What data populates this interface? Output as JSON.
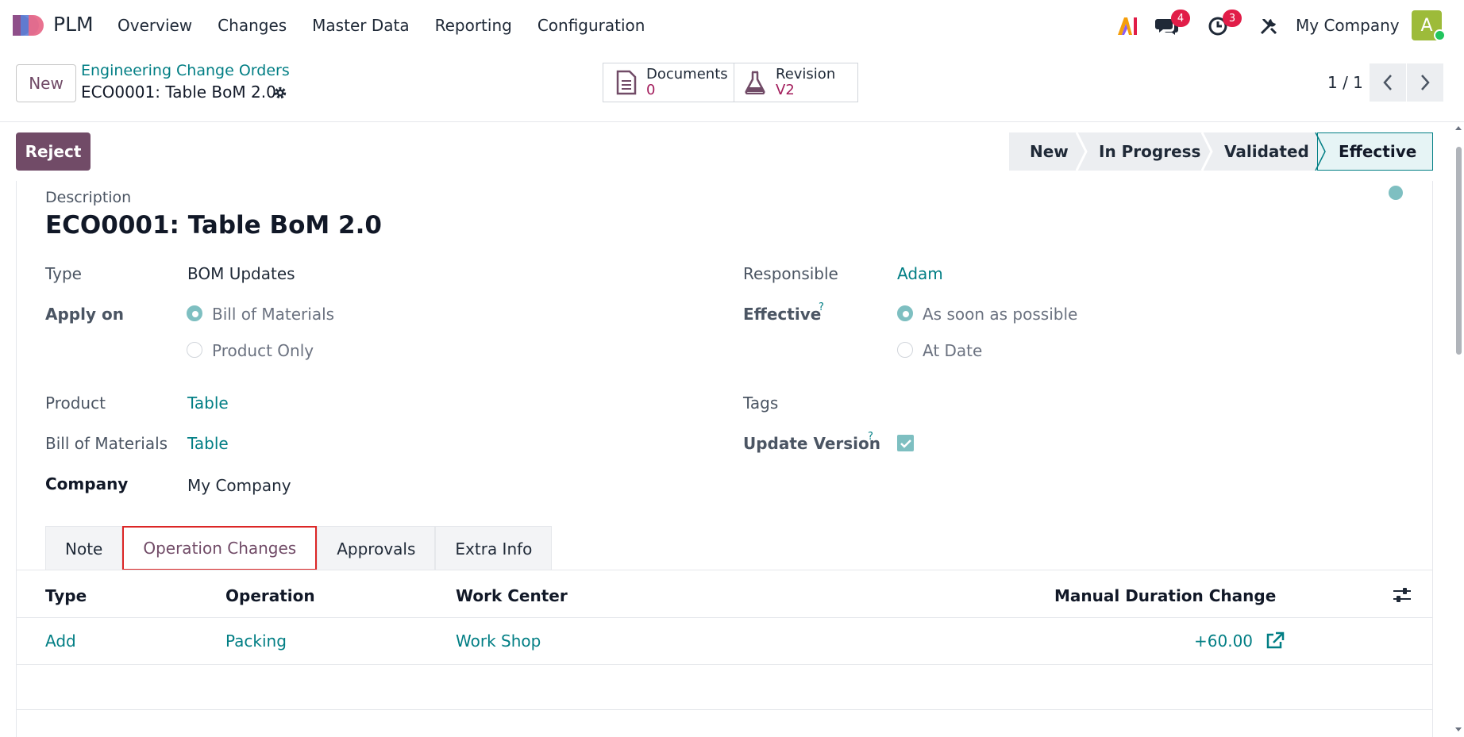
{
  "navbar": {
    "app_name": "PLM",
    "menu": [
      "Overview",
      "Changes",
      "Master Data",
      "Reporting",
      "Configuration"
    ],
    "messages_count": "4",
    "activities_count": "3",
    "company": "My Company",
    "avatar_letter": "A"
  },
  "control": {
    "new_label": "New",
    "breadcrumb_parent": "Engineering Change Orders",
    "breadcrumb_current": "ECO0001: Table BoM 2.0",
    "documents_label": "Documents",
    "documents_value": "0",
    "revision_label": "Revision",
    "revision_value": "V2",
    "pager": "1 / 1"
  },
  "statusbar": {
    "reject_label": "Reject",
    "stages": [
      "New",
      "In Progress",
      "Validated",
      "Effective"
    ],
    "active_stage": "Effective"
  },
  "form": {
    "description_label": "Description",
    "title": "ECO0001: Table BoM 2.0",
    "type_label": "Type",
    "type_value": "BOM Updates",
    "apply_on_label": "Apply on",
    "apply_on_options": [
      "Bill of Materials",
      "Product Only"
    ],
    "apply_on_selected": "Bill of Materials",
    "product_label": "Product",
    "product_value": "Table",
    "bom_label": "Bill of Materials",
    "bom_value": "Table",
    "company_label": "Company",
    "company_value": "My Company",
    "responsible_label": "Responsible",
    "responsible_value": "Adam",
    "effective_label": "Effective",
    "effective_options": [
      "As soon as possible",
      "At Date"
    ],
    "effective_selected": "As soon as possible",
    "tags_label": "Tags",
    "update_version_label": "Update Version",
    "update_version_checked": true,
    "help_mark": "?"
  },
  "tabs": [
    "Note",
    "Operation Changes",
    "Approvals",
    "Extra Info"
  ],
  "active_tab": "Operation Changes",
  "table": {
    "headers": [
      "Type",
      "Operation",
      "Work Center",
      "Manual Duration Change"
    ],
    "rows": [
      {
        "type": "Add",
        "operation": "Packing",
        "work_center": "Work Shop",
        "duration": "+60.00"
      }
    ]
  },
  "colors": {
    "brand": "#714b67",
    "link": "#017e84",
    "badge": "#e11d48"
  }
}
